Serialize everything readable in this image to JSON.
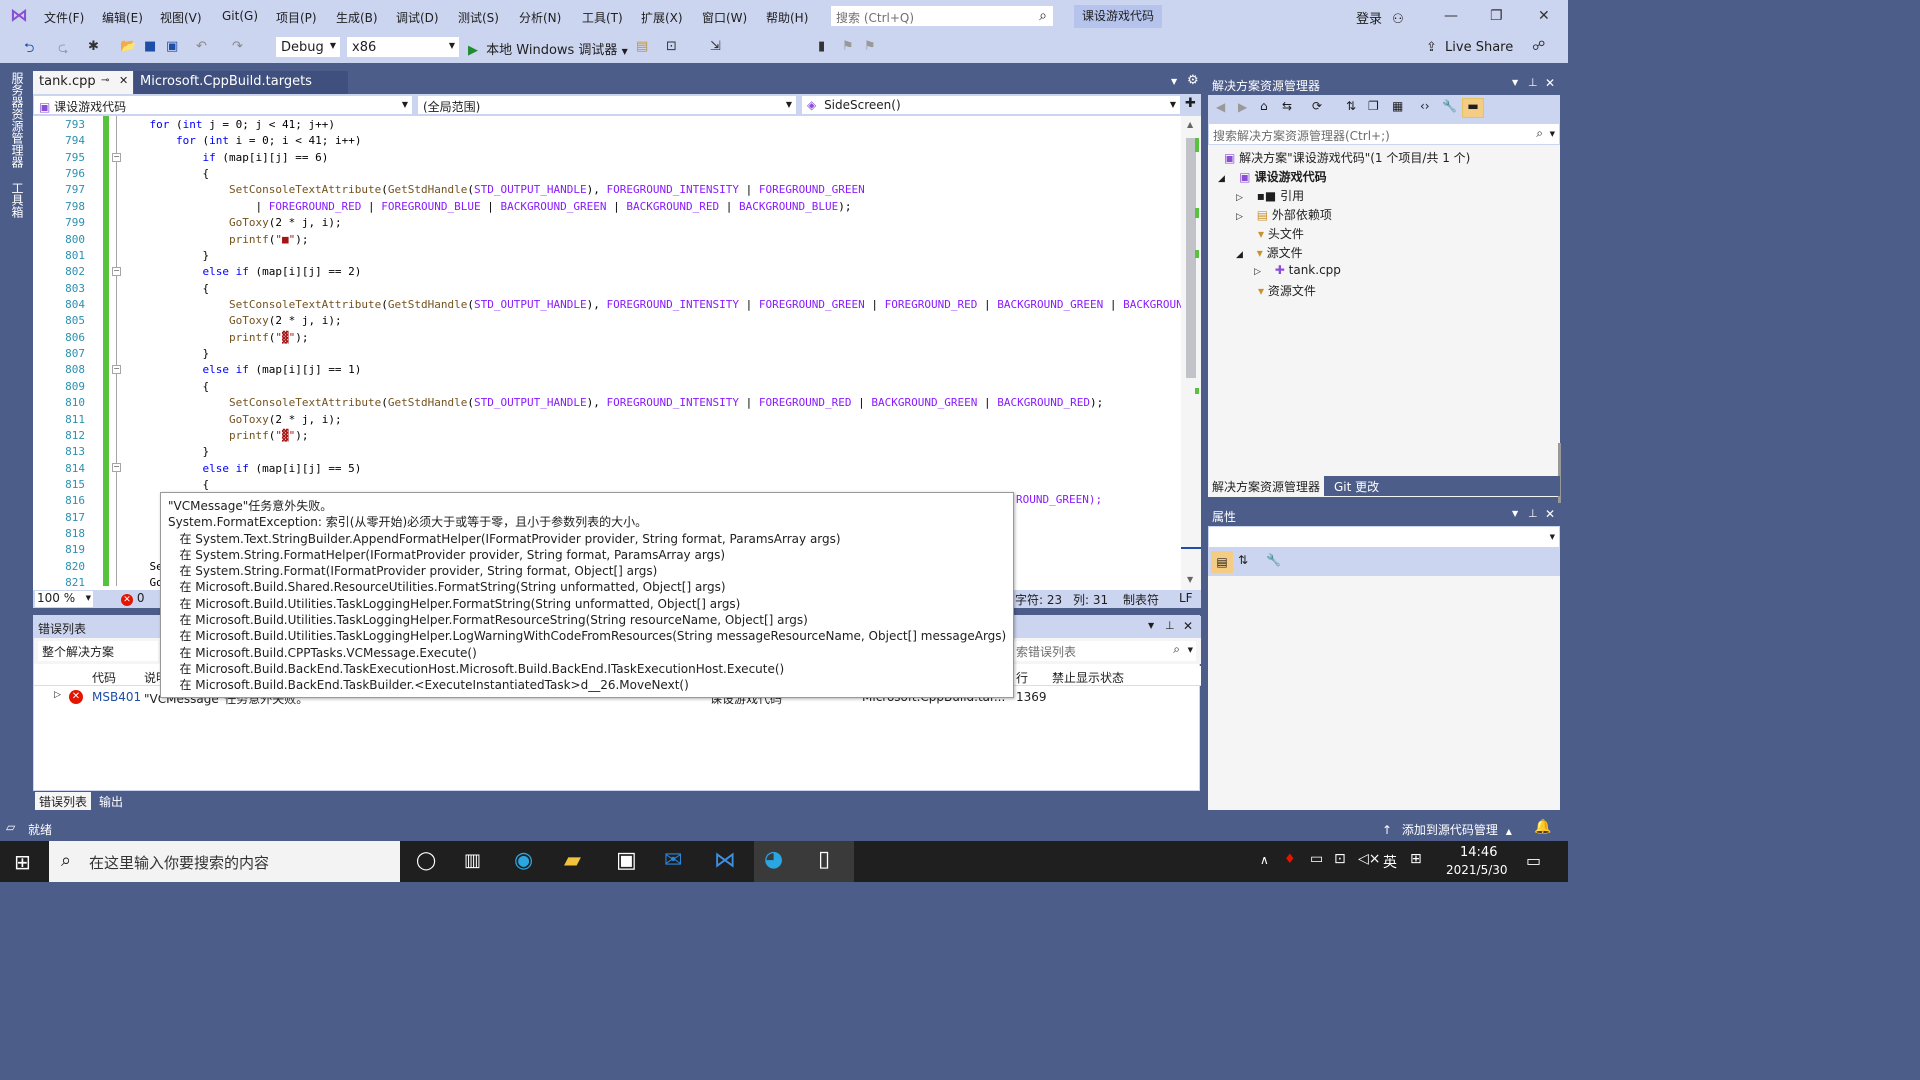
{
  "titlebar": {
    "menus": [
      "文件(F)",
      "编辑(E)",
      "视图(V)",
      "Git(G)",
      "项目(P)",
      "生成(B)",
      "调试(D)",
      "测试(S)",
      "分析(N)",
      "工具(T)",
      "扩展(X)",
      "窗口(W)",
      "帮助(H)"
    ],
    "search_placeholder": "搜索 (Ctrl+Q)",
    "project_name": "课设游戏代码",
    "login": "登录"
  },
  "toolbar": {
    "config": "Debug",
    "platform": "x86",
    "run_label": "本地 Windows 调试器",
    "live_share": "Live Share"
  },
  "sidetabs": [
    "服务器资源管理器",
    "工具箱"
  ],
  "doctabs": [
    {
      "label": "tank.cpp"
    },
    {
      "label": "Microsoft.CppBuild.targets"
    }
  ],
  "navbar": {
    "project": "课设游戏代码",
    "scope": "(全局范围)",
    "member": "SideScreen()"
  },
  "editor": {
    "lines": [
      {
        "n": "793",
        "parts": [
          [
            "    ",
            ""
          ],
          [
            "for",
            "kw"
          ],
          [
            " (",
            ""
          ],
          [
            "int",
            "kw"
          ],
          [
            " j = 0; j < 41; j++)",
            ""
          ]
        ]
      },
      {
        "n": "794",
        "parts": [
          [
            "        ",
            ""
          ],
          [
            "for",
            "kw"
          ],
          [
            " (",
            ""
          ],
          [
            "int",
            "kw"
          ],
          [
            " i = 0; i < 41; i++)",
            ""
          ]
        ]
      },
      {
        "n": "795",
        "parts": [
          [
            "            ",
            ""
          ],
          [
            "if",
            "kw"
          ],
          [
            " (map[i][j] == 6)",
            ""
          ]
        ]
      },
      {
        "n": "796",
        "parts": [
          [
            "            {",
            ""
          ]
        ]
      },
      {
        "n": "797",
        "parts": [
          [
            "                ",
            ""
          ],
          [
            "SetConsoleTextAttribute",
            "fn"
          ],
          [
            "(",
            ""
          ],
          [
            "GetStdHandle",
            "fn"
          ],
          [
            "(",
            ""
          ],
          [
            "STD_OUTPUT_HANDLE",
            "mac"
          ],
          [
            "), ",
            ""
          ],
          [
            "FOREGROUND_INTENSITY",
            "mac"
          ],
          [
            " | ",
            ""
          ],
          [
            "FOREGROUND_GREEN",
            "mac"
          ]
        ]
      },
      {
        "n": "798",
        "parts": [
          [
            "                    | ",
            ""
          ],
          [
            "FOREGROUND_RED",
            "mac"
          ],
          [
            " | ",
            ""
          ],
          [
            "FOREGROUND_BLUE",
            "mac"
          ],
          [
            " | ",
            ""
          ],
          [
            "BACKGROUND_GREEN",
            "mac"
          ],
          [
            " | ",
            ""
          ],
          [
            "BACKGROUND_RED",
            "mac"
          ],
          [
            " | ",
            ""
          ],
          [
            "BACKGROUND_BLUE",
            "mac"
          ],
          [
            ");",
            ""
          ]
        ]
      },
      {
        "n": "799",
        "parts": [
          [
            "                ",
            ""
          ],
          [
            "GoToxy",
            "fn"
          ],
          [
            "(2 * j, i);",
            ""
          ]
        ]
      },
      {
        "n": "800",
        "parts": [
          [
            "                ",
            ""
          ],
          [
            "printf",
            "fn"
          ],
          [
            "(",
            ""
          ],
          [
            "\"■\"",
            "str"
          ],
          [
            ");",
            ""
          ]
        ]
      },
      {
        "n": "801",
        "parts": [
          [
            "            }",
            ""
          ]
        ]
      },
      {
        "n": "802",
        "parts": [
          [
            "            ",
            ""
          ],
          [
            "else if",
            "kw"
          ],
          [
            " (map[i][j] == 2)",
            ""
          ]
        ]
      },
      {
        "n": "803",
        "parts": [
          [
            "            {",
            ""
          ]
        ]
      },
      {
        "n": "804",
        "parts": [
          [
            "                ",
            ""
          ],
          [
            "SetConsoleTextAttribute",
            "fn"
          ],
          [
            "(",
            ""
          ],
          [
            "GetStdHandle",
            "fn"
          ],
          [
            "(",
            ""
          ],
          [
            "STD_OUTPUT_HANDLE",
            "mac"
          ],
          [
            "), ",
            ""
          ],
          [
            "FOREGROUND_INTENSITY",
            "mac"
          ],
          [
            " | ",
            ""
          ],
          [
            "FOREGROUND_GREEN",
            "mac"
          ],
          [
            " | ",
            ""
          ],
          [
            "FOREGROUND_RED",
            "mac"
          ],
          [
            " | ",
            ""
          ],
          [
            "BACKGROUND_GREEN",
            "mac"
          ],
          [
            " | ",
            ""
          ],
          [
            "BACKGROUND_",
            "mac"
          ]
        ]
      },
      {
        "n": "805",
        "parts": [
          [
            "                ",
            ""
          ],
          [
            "GoToxy",
            "fn"
          ],
          [
            "(2 * j, i);",
            ""
          ]
        ]
      },
      {
        "n": "806",
        "parts": [
          [
            "                ",
            ""
          ],
          [
            "printf",
            "fn"
          ],
          [
            "(",
            ""
          ],
          [
            "\"▓\"",
            "str"
          ],
          [
            ");",
            ""
          ]
        ]
      },
      {
        "n": "807",
        "parts": [
          [
            "            }",
            ""
          ]
        ]
      },
      {
        "n": "808",
        "parts": [
          [
            "            ",
            ""
          ],
          [
            "else if",
            "kw"
          ],
          [
            " (map[i][j] == 1)",
            ""
          ]
        ]
      },
      {
        "n": "809",
        "parts": [
          [
            "            {",
            ""
          ]
        ]
      },
      {
        "n": "810",
        "parts": [
          [
            "                ",
            ""
          ],
          [
            "SetConsoleTextAttribute",
            "fn"
          ],
          [
            "(",
            ""
          ],
          [
            "GetStdHandle",
            "fn"
          ],
          [
            "(",
            ""
          ],
          [
            "STD_OUTPUT_HANDLE",
            "mac"
          ],
          [
            "), ",
            ""
          ],
          [
            "FOREGROUND_INTENSITY",
            "mac"
          ],
          [
            " | ",
            ""
          ],
          [
            "FOREGROUND_RED",
            "mac"
          ],
          [
            " | ",
            ""
          ],
          [
            "BACKGROUND_GREEN",
            "mac"
          ],
          [
            " | ",
            ""
          ],
          [
            "BACKGROUND_RED",
            "mac"
          ],
          [
            ");",
            ""
          ]
        ]
      },
      {
        "n": "811",
        "parts": [
          [
            "                ",
            ""
          ],
          [
            "GoToxy",
            "fn"
          ],
          [
            "(2 * j, i);",
            ""
          ]
        ]
      },
      {
        "n": "812",
        "parts": [
          [
            "                ",
            ""
          ],
          [
            "printf",
            "fn"
          ],
          [
            "(",
            ""
          ],
          [
            "\"▓\"",
            "str"
          ],
          [
            ");",
            ""
          ]
        ]
      },
      {
        "n": "813",
        "parts": [
          [
            "            }",
            ""
          ]
        ]
      },
      {
        "n": "814",
        "parts": [
          [
            "            ",
            ""
          ],
          [
            "else if",
            "kw"
          ],
          [
            " (map[i][j] == 5)",
            ""
          ]
        ]
      },
      {
        "n": "815",
        "parts": [
          [
            "            {",
            ""
          ]
        ]
      },
      {
        "n": "816",
        "parts": [
          [
            "",
            ""
          ]
        ]
      },
      {
        "n": "817",
        "parts": [
          [
            "",
            ""
          ]
        ]
      },
      {
        "n": "818",
        "parts": [
          [
            "",
            ""
          ]
        ]
      },
      {
        "n": "819",
        "parts": [
          [
            "",
            ""
          ]
        ]
      },
      {
        "n": "820",
        "parts": [
          [
            "    Se",
            ""
          ]
        ]
      },
      {
        "n": "821",
        "parts": [
          [
            "    Go",
            ""
          ]
        ]
      }
    ],
    "line816_tail": "ROUND_GREEN);"
  },
  "statusrow": {
    "zoom": "100 %",
    "errors": "0",
    "char": "字符: 23",
    "col": "列: 31",
    "tab": "制表符",
    "eol": "LF"
  },
  "errlist": {
    "title": "错误列表",
    "scope": "整个解决方案",
    "search_placeholder": "索错误列表",
    "columns": [
      "代码",
      "说明",
      "行",
      "禁止显示状态"
    ],
    "row": {
      "code": "MSB401",
      "desc": "\"VCMessage\"任务意外失败。",
      "project": "课设游戏代码",
      "file": "Microsoft.CppBuild.tar...",
      "line": "1369"
    }
  },
  "bottabs": [
    "错误列表",
    "输出"
  ],
  "solution": {
    "title": "解决方案资源管理器",
    "search_placeholder": "搜索解决方案资源管理器(Ctrl+;)",
    "root": "解决方案\"课设游戏代码\"(1 个项目/共 1 个)",
    "project": "课设游戏代码",
    "items": [
      "引用",
      "外部依赖项",
      "头文件",
      "源文件",
      "tank.cpp",
      "资源文件"
    ],
    "tabs": [
      "解决方案资源管理器",
      "Git 更改"
    ]
  },
  "props": {
    "title": "属性"
  },
  "status": {
    "ready": "就绪",
    "source_control": "添加到源代码管理"
  },
  "tooltip": {
    "lines": [
      "\"VCMessage\"任务意外失败。",
      "System.FormatException: 索引(从零开始)必须大于或等于零，且小于参数列表的大小。",
      "   在 System.Text.StringBuilder.AppendFormatHelper(IFormatProvider provider, String format, ParamsArray args)",
      "   在 System.String.FormatHelper(IFormatProvider provider, String format, ParamsArray args)",
      "   在 System.String.Format(IFormatProvider provider, String format, Object[] args)",
      "   在 Microsoft.Build.Shared.ResourceUtilities.FormatString(String unformatted, Object[] args)",
      "   在 Microsoft.Build.Utilities.TaskLoggingHelper.FormatString(String unformatted, Object[] args)",
      "   在 Microsoft.Build.Utilities.TaskLoggingHelper.FormatResourceString(String resourceName, Object[] args)",
      "   在 Microsoft.Build.Utilities.TaskLoggingHelper.LogWarningWithCodeFromResources(String messageResourceName, Object[] messageArgs)",
      "   在 Microsoft.Build.CPPTasks.VCMessage.Execute()",
      "   在 Microsoft.Build.BackEnd.TaskExecutionHost.Microsoft.Build.BackEnd.ITaskExecutionHost.Execute()",
      "   在 Microsoft.Build.BackEnd.TaskBuilder.<ExecuteInstantiatedTask>d__26.MoveNext()"
    ]
  },
  "taskbar": {
    "search_placeholder": "在这里输入你要搜索的内容",
    "time": "14:46",
    "date": "2021/5/30",
    "ime": "英"
  }
}
